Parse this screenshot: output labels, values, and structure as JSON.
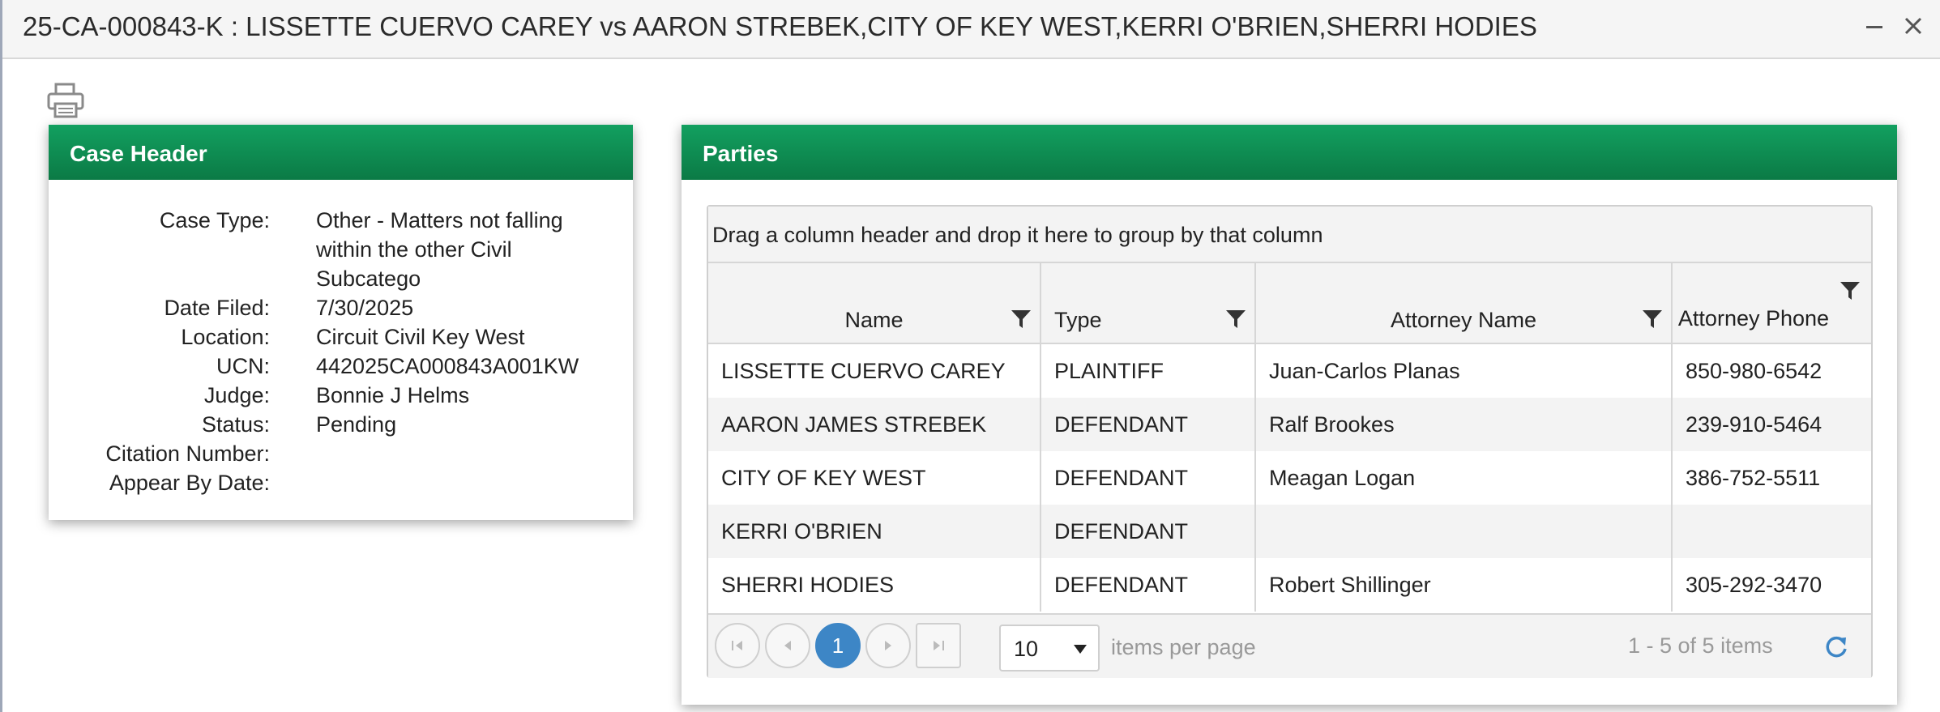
{
  "window": {
    "title": "25-CA-000843-K : LISSETTE CUERVO CAREY vs AARON STREBEK,CITY OF KEY WEST,KERRI O'BRIEN,SHERRI HODIES",
    "controls": {
      "minimize_icon": "minimize-icon",
      "close_icon": "close-icon"
    }
  },
  "toolbar": {
    "print_icon": "printer-icon"
  },
  "case_header": {
    "title": "Case Header",
    "rows": [
      {
        "label": "Case Type:",
        "value": "Other - Matters not falling within the other Civil Subcatego"
      },
      {
        "label": "Date Filed:",
        "value": "7/30/2025"
      },
      {
        "label": "Location:",
        "value": "Circuit Civil Key West"
      },
      {
        "label": "UCN:",
        "value": "442025CA000843A001KW"
      },
      {
        "label": "Judge:",
        "value": "Bonnie J Helms"
      },
      {
        "label": "Status:",
        "value": "Pending"
      },
      {
        "label": "Citation Number:",
        "value": ""
      },
      {
        "label": "Appear By Date:",
        "value": ""
      }
    ]
  },
  "parties": {
    "title": "Parties",
    "group_hint": "Drag a column header and drop it here to group by that column",
    "columns": [
      "Name",
      "Type",
      "Attorney Name",
      "Attorney Phone"
    ],
    "rows": [
      {
        "name": "LISSETTE CUERVO CAREY",
        "type": "PLAINTIFF",
        "attorney": "Juan-Carlos Planas",
        "phone": "850-980-6542"
      },
      {
        "name": "AARON JAMES STREBEK",
        "type": "DEFENDANT",
        "attorney": "Ralf Brookes",
        "phone": "239-910-5464"
      },
      {
        "name": "CITY OF KEY WEST",
        "type": "DEFENDANT",
        "attorney": "Meagan Logan",
        "phone": "386-752-5511"
      },
      {
        "name": "KERRI O'BRIEN",
        "type": "DEFENDANT",
        "attorney": "",
        "phone": ""
      },
      {
        "name": "SHERRI HODIES",
        "type": "DEFENDANT",
        "attorney": "Robert Shillinger",
        "phone": "305-292-3470"
      }
    ],
    "pager": {
      "current_page": "1",
      "page_size": "10",
      "items_per_page_label": "items per page",
      "info": "1 - 5 of 5 items"
    }
  },
  "colors": {
    "header_green": "#0b8a4f",
    "pager_blue": "#3d86c6"
  }
}
